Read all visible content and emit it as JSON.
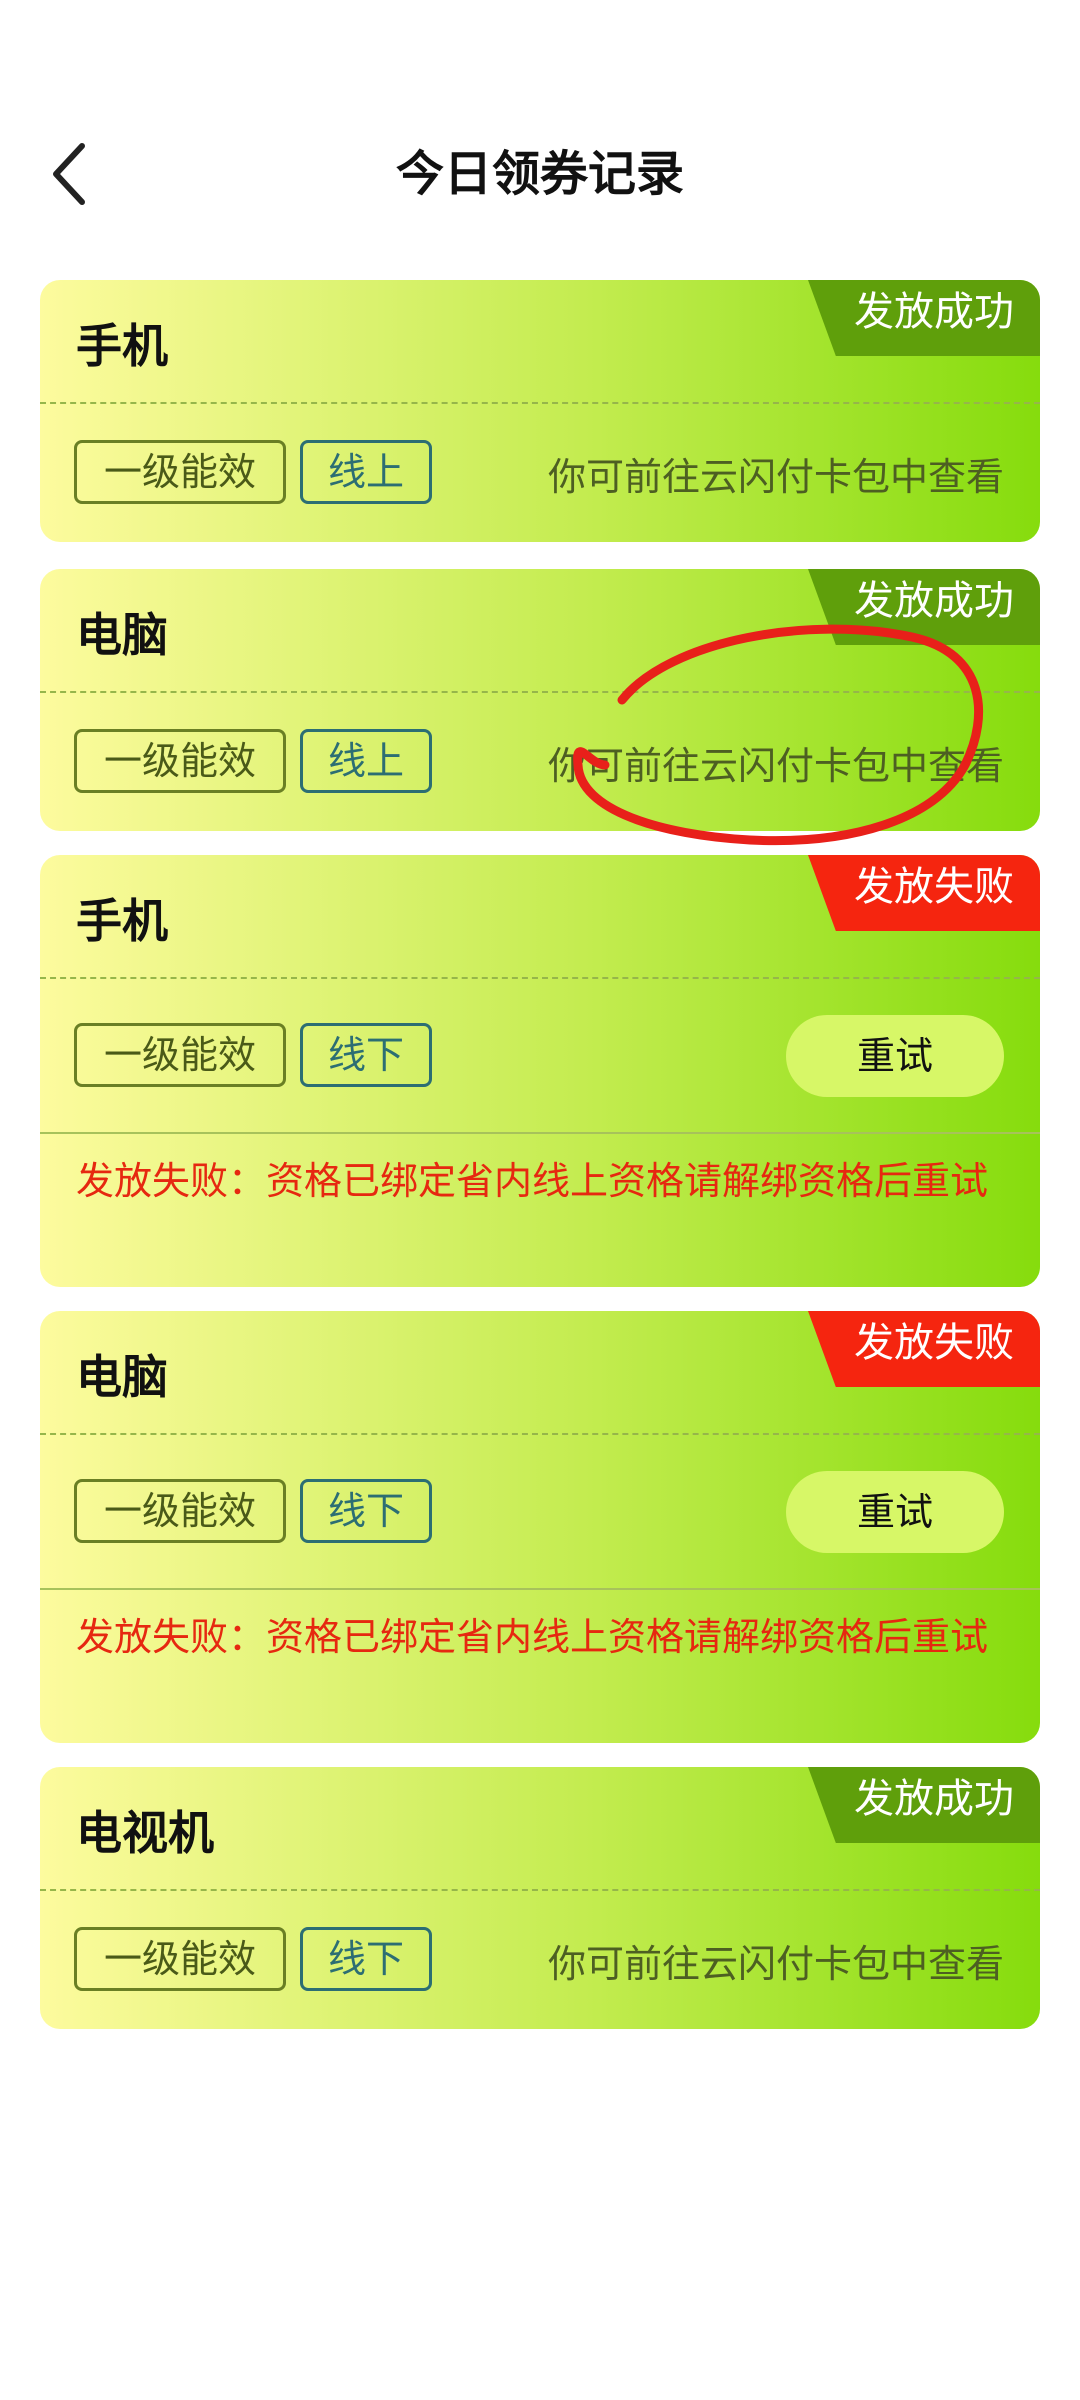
{
  "header": {
    "title": "今日领券记录",
    "back_icon": "chevron-left-icon"
  },
  "colors": {
    "success_badge": "#5f9f0b",
    "fail_badge": "#f5250f",
    "error_text": "#e62810",
    "retry_button": "#d7f767",
    "annotation_stroke": "#e8201a"
  },
  "records": [
    {
      "product": "手机",
      "status": "发放成功",
      "grade": "一级能效",
      "channel": "线上",
      "hint": "你可前往云闪付卡包中查看"
    },
    {
      "product": "电脑",
      "status": "发放成功",
      "grade": "一级能效",
      "channel": "线上",
      "hint": "你可前往云闪付卡包中查看"
    },
    {
      "product": "手机",
      "status": "发放失败",
      "grade": "一级能效",
      "channel": "线下",
      "retry": "重试",
      "error": "发放失败：资格已绑定省内线上资格请解绑资格后重试"
    },
    {
      "product": "电脑",
      "status": "发放失败",
      "grade": "一级能效",
      "channel": "线下",
      "retry": "重试",
      "error": "发放失败：资格已绑定省内线上资格请解绑资格后重试"
    },
    {
      "product": "电视机",
      "status": "发放成功",
      "grade": "一级能效",
      "channel": "线下",
      "hint": "你可前往云闪付卡包中查看"
    }
  ]
}
